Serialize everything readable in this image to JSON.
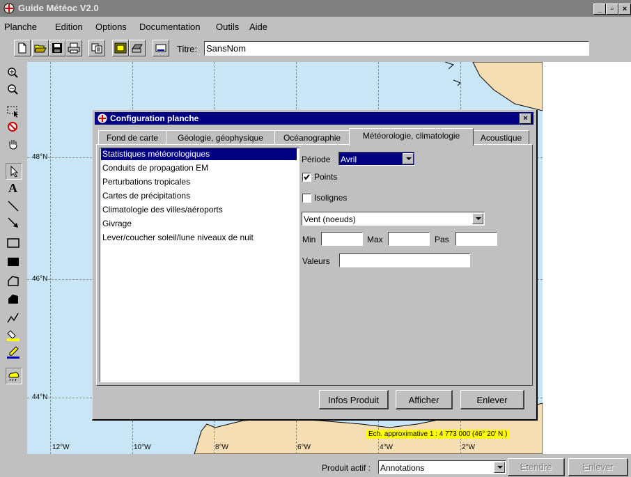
{
  "app": {
    "title": "Guide Météoc V2.0",
    "window_controls": [
      "_",
      "▫",
      "×"
    ]
  },
  "menubar": {
    "items": [
      "Planche",
      "Edition",
      "Options",
      "Documentation",
      "Outils",
      "Aide"
    ]
  },
  "toolbar": {
    "title_label": "Titre:",
    "title_value": "SansNom",
    "buttons": [
      "new-icon",
      "open-icon",
      "save-icon",
      "print-icon",
      "copy-icon",
      "frame-icon",
      "printer-preview-icon",
      "screen-icon"
    ]
  },
  "tools": [
    "zoom-in-icon",
    "zoom-out-icon",
    "select-zoom-icon",
    "no-zoom-icon",
    "pan-hand-icon",
    "pointer-icon",
    "text-icon",
    "line-icon",
    "arrow-icon",
    "rectangle-icon",
    "filled-rectangle-icon",
    "polygon-icon",
    "filled-polygon-icon",
    "polyline-icon",
    "fill-color-icon",
    "line-color-icon",
    "weather-symbol-icon"
  ],
  "map": {
    "latitudes": [
      "48°N",
      "46°N",
      "44°N"
    ],
    "longitudes": [
      "12°W",
      "10°W",
      "8°W",
      "6°W",
      "4°W",
      "2°W"
    ],
    "scale_text": "Ech. approximative 1 : 4 773 000 (46° 20' N )"
  },
  "dialog": {
    "title": "Configuration planche",
    "close": "×",
    "tabs": [
      "Fond de carte",
      "Géologie, géophysique",
      "Océanographie",
      "Météorologie, climatologie",
      "Acoustique"
    ],
    "active_tab": "Météorologie, climatologie",
    "list_items": [
      "Statistiques météorologiques",
      "Conduits de propagation EM",
      "Perturbations tropicales",
      "Cartes de précipitations",
      "Climatologie des villes/aéroports",
      "Givrage",
      "Lever/coucher soleil/lune niveaux de nuit"
    ],
    "selected_item": "Statistiques météorologiques",
    "periode_label": "Période",
    "periode_value": "Avril",
    "points_label": "Points",
    "points_checked": true,
    "isolignes_label": "Isolignes",
    "isolignes_checked": false,
    "parameter_value": "Vent (noeuds)",
    "min_label": "Min",
    "max_label": "Max",
    "pas_label": "Pas",
    "min_value": "",
    "max_value": "",
    "pas_value": "",
    "valeurs_label": "Valeurs",
    "valeurs_value": "",
    "buttons": {
      "infos": "Infos Produit",
      "afficher": "Afficher",
      "enlever": "Enlever"
    }
  },
  "statusbar": {
    "produit_label": "Produit actif :",
    "produit_value": "Annotations",
    "etendre": "Etendre",
    "enlever": "Enlever"
  },
  "colors": {
    "sea": "#c8e6f5",
    "land": "#f5deb3",
    "titlebar_active": "#000080",
    "titlebar_inactive": "#808080",
    "scale_bg": "#ffff00"
  }
}
